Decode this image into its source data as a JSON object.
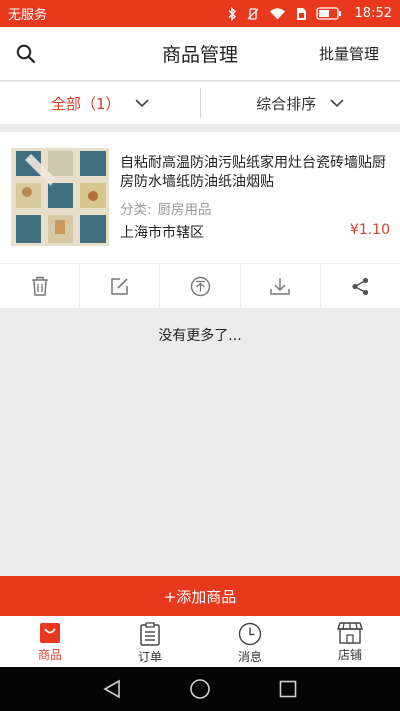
{
  "status_bar": {
    "carrier": "无服务",
    "time": "18:52",
    "accent_color": "#e8381e"
  },
  "header": {
    "title": "商品管理",
    "batch_manage": "批量管理"
  },
  "filters": {
    "all_label": "全部",
    "all_count": "（1）",
    "sort_label": "综合排序"
  },
  "product": {
    "name": "自粘耐高温防油污贴纸家用灶台瓷砖墙贴厨房防水墙纸防油纸油烟贴",
    "category_label": "分类:",
    "category_value": "厨房用品",
    "location": "上海市市辖区",
    "price": "¥1.10",
    "actions": [
      "delete-icon",
      "edit-icon",
      "publish-icon",
      "download-icon",
      "share-icon"
    ]
  },
  "list_footer": "没有更多了...",
  "add_button": "+添加商品",
  "tabs": [
    {
      "label": "商品",
      "icon": "bag-icon",
      "active": true
    },
    {
      "label": "订单",
      "icon": "clipboard-icon",
      "active": false
    },
    {
      "label": "消息",
      "icon": "clock-icon",
      "active": false
    },
    {
      "label": "店铺",
      "icon": "store-icon",
      "active": false
    }
  ],
  "colors": {
    "brand_red": "#e8381e",
    "price_red": "#d8402a"
  }
}
